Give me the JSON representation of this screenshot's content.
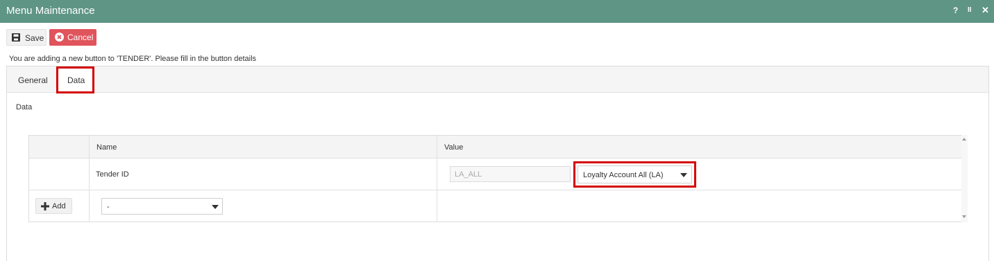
{
  "window": {
    "title": "Menu Maintenance",
    "controls": {
      "help": "?",
      "pause": "II",
      "close": "✕"
    }
  },
  "toolbar": {
    "save_label": "Save",
    "cancel_label": "Cancel"
  },
  "info_text": "You are adding a new button to 'TENDER'. Please fill in the button details",
  "tabs": [
    {
      "label": "General",
      "active": false
    },
    {
      "label": "Data",
      "active": true
    }
  ],
  "section_label": "Data",
  "grid": {
    "columns": [
      "Name",
      "Value"
    ],
    "rows": [
      {
        "name": "Tender ID",
        "value_text": "LA_ALL",
        "value_select": "Loyalty Account All (LA)"
      }
    ],
    "add_label": "Add",
    "add_select_value": "-"
  },
  "colors": {
    "titlebar": "#5f9585",
    "cancel": "#e0545c",
    "highlight": "#d40000"
  }
}
